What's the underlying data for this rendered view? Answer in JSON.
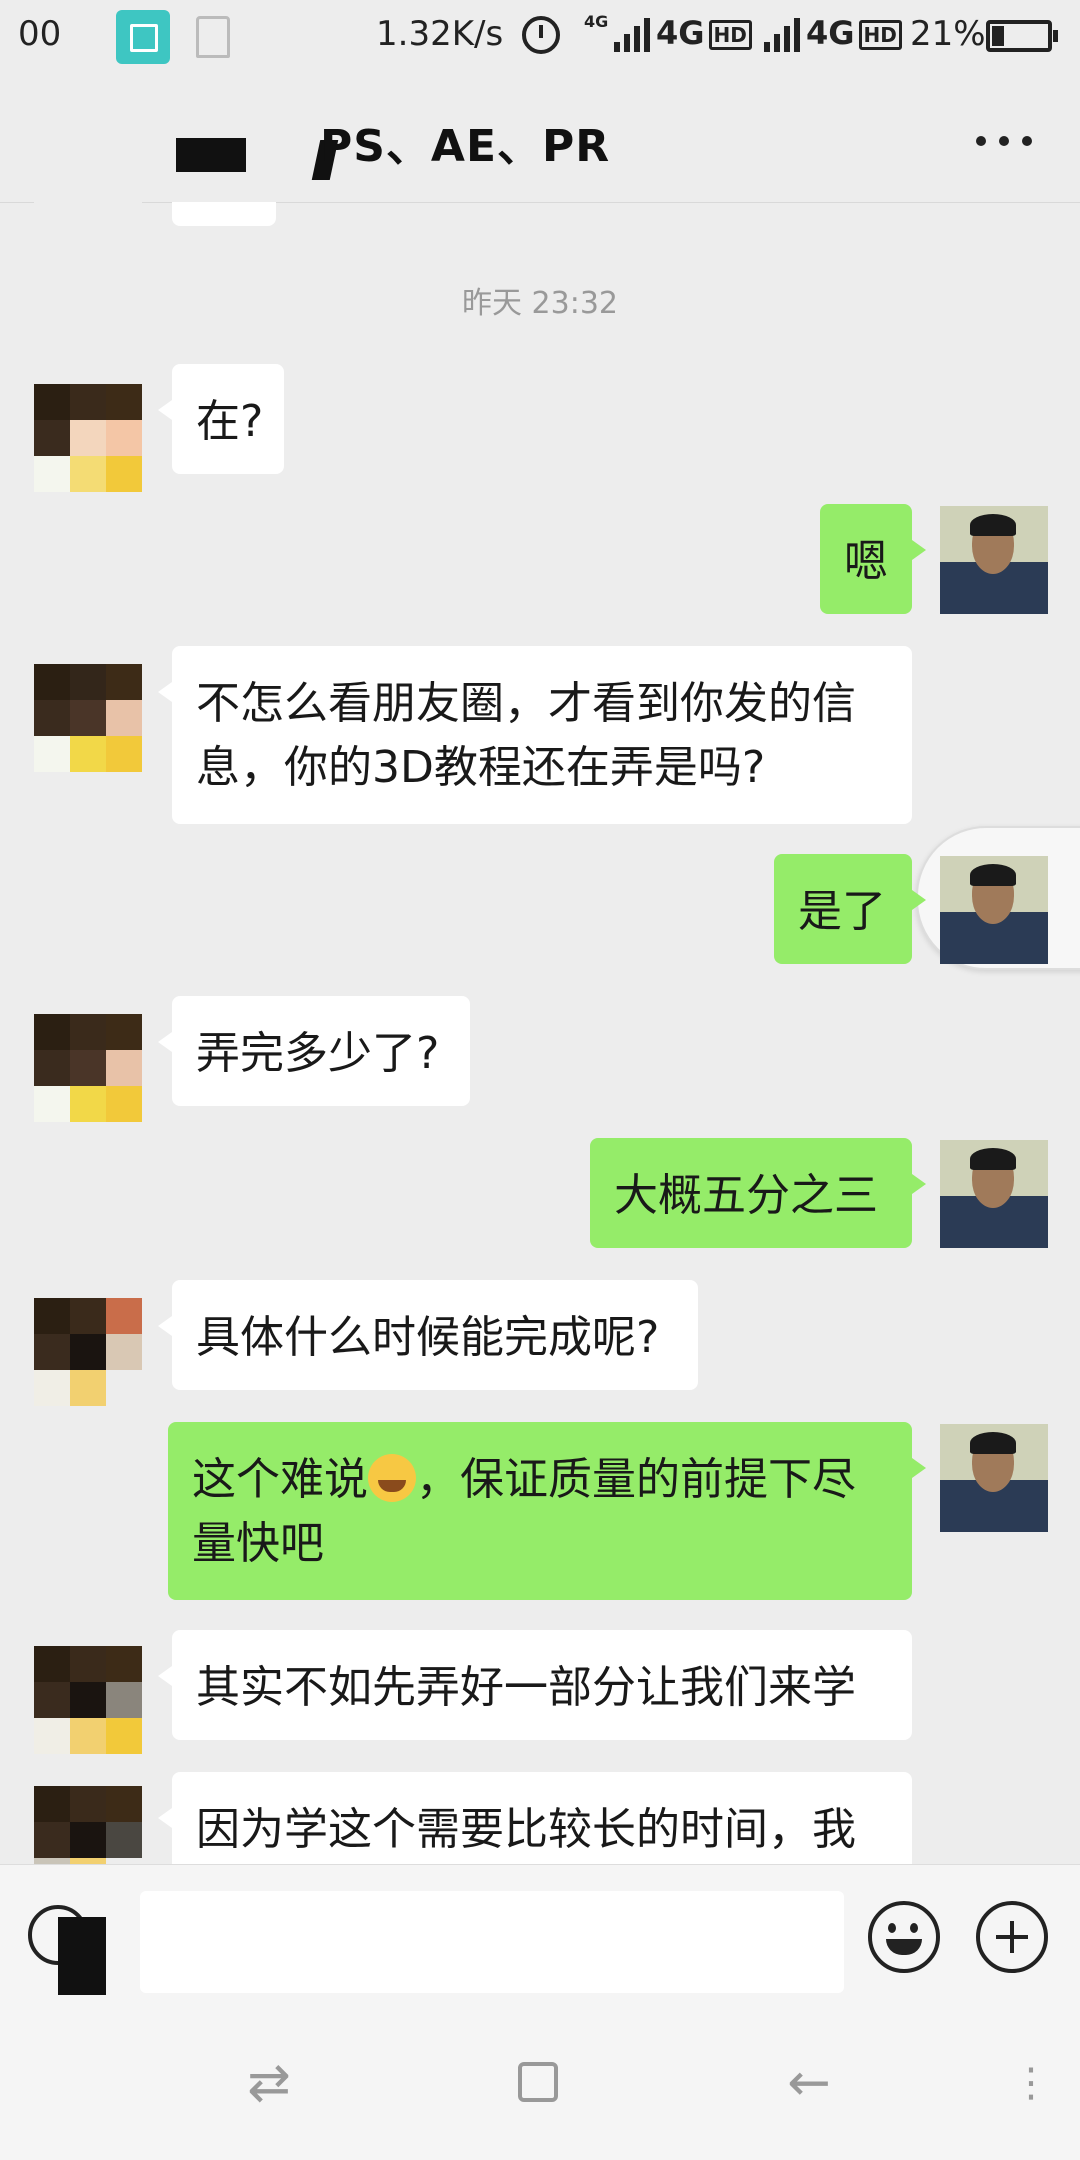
{
  "status_bar": {
    "left_text": "00",
    "net_speed": "1.32K/s",
    "net1": "4G",
    "net1_hd": "HD",
    "net2": "4G",
    "net2_hd": "HD",
    "net_small": "4G",
    "battery": "21%"
  },
  "header": {
    "title": "PS、AE、PR"
  },
  "chat": {
    "timestamp": "昨天 23:32",
    "messages": [
      {
        "from": "them",
        "text": "在?"
      },
      {
        "from": "me",
        "text": "嗯"
      },
      {
        "from": "them",
        "text": "不怎么看朋友圈，才看到你发的信息，你的3D教程还在弄是吗?"
      },
      {
        "from": "me",
        "text": "是了"
      },
      {
        "from": "them",
        "text": "弄完多少了?"
      },
      {
        "from": "me",
        "text": "大概五分之三"
      },
      {
        "from": "them",
        "text": "具体什么时候能完成呢?"
      },
      {
        "from": "me",
        "text_a": "这个难说",
        "text_b": "，保证质量的前提下尽量快吧"
      },
      {
        "from": "them",
        "text": "其实不如先弄好一部分让我们来学"
      },
      {
        "from": "them",
        "text": "因为学这个需要比较长的时间，我"
      }
    ]
  },
  "input": {
    "placeholder": ""
  },
  "colors": {
    "background": "#ededed",
    "bubble_me": "#95ec69",
    "bubble_them": "#ffffff"
  }
}
